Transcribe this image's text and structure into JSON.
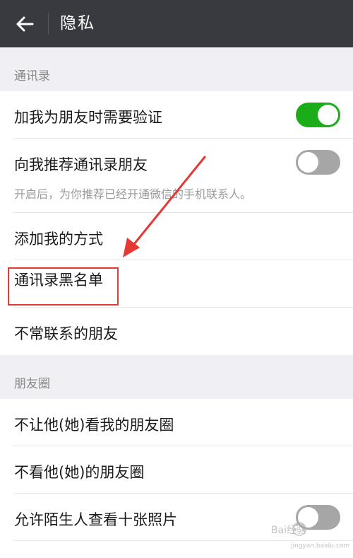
{
  "header": {
    "title": "隐私",
    "back_icon": "arrow-left-icon",
    "background": "#393a3f"
  },
  "sections": [
    {
      "title": "通讯录",
      "items": [
        {
          "label": "加我为朋友时需要验证",
          "toggle": true
        },
        {
          "label": "向我推荐通讯录朋友",
          "toggle": false,
          "hint": "开启后，为你推荐已经开通微信的手机联系人。"
        },
        {
          "label": "添加我的方式"
        },
        {
          "label": "通讯录黑名单",
          "highlighted": true
        },
        {
          "label": "不常联系的朋友"
        }
      ]
    },
    {
      "title": "朋友圈",
      "items": [
        {
          "label": "不让他(她)看我的朋友圈"
        },
        {
          "label": "不看他(她)的朋友圈"
        },
        {
          "label": "允许陌生人查看十张照片",
          "toggle": false
        }
      ]
    }
  ],
  "annotation": {
    "highlight_color": "#e53935",
    "arrow_target": "通讯录黑名单"
  },
  "colors": {
    "toggle_on": "#1aad19",
    "toggle_off": "#a6a6a6",
    "page_background": "#efeff4"
  },
  "watermark": {
    "text": "Bai经验",
    "subtext": "jingyan.baidu.com"
  }
}
